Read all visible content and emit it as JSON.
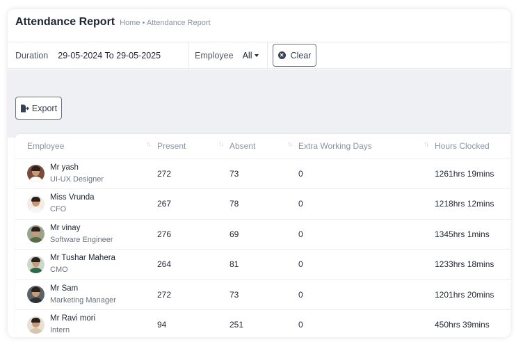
{
  "header": {
    "title": "Attendance Report",
    "breadcrumb": "Home • Attendance Report"
  },
  "filters": {
    "duration_label": "Duration",
    "duration_value": "29-05-2024 To 29-05-2025",
    "employee_label": "Employee",
    "employee_value": "All",
    "clear_label": "Clear"
  },
  "toolbar": {
    "export_label": "Export"
  },
  "table": {
    "columns": [
      "Employee",
      "Present",
      "Absent",
      "Extra Working Days",
      "Hours Clocked"
    ],
    "rows": [
      {
        "name": "Mr yash",
        "role": "UI-UX Designer",
        "present": "272",
        "absent": "73",
        "extra": "0",
        "hours": "1261hrs 19mins",
        "avatar_bg": "#7a4b3a",
        "shirt": "#ffffff"
      },
      {
        "name": "Miss Vrunda",
        "role": "CFO",
        "present": "267",
        "absent": "78",
        "extra": "0",
        "hours": "1218hrs 12mins",
        "avatar_bg": "#f1ece6",
        "shirt": "#f5f5f5"
      },
      {
        "name": "Mr vinay",
        "role": "Software Engineer",
        "present": "276",
        "absent": "69",
        "extra": "0",
        "hours": "1345hrs 1mins",
        "avatar_bg": "#9aa38c",
        "shirt": "#5a6b4a"
      },
      {
        "name": "Mr Tushar Mahera",
        "role": "CMO",
        "present": "264",
        "absent": "81",
        "extra": "0",
        "hours": "1233hrs 18mins",
        "avatar_bg": "#cfd8c8",
        "shirt": "#2f6b4a"
      },
      {
        "name": "Mr Sam",
        "role": "Marketing Manager",
        "present": "272",
        "absent": "73",
        "extra": "0",
        "hours": "1201hrs 20mins",
        "avatar_bg": "#5b6168",
        "shirt": "#2d3238"
      },
      {
        "name": "Mr Ravi mori",
        "role": "Intern",
        "present": "94",
        "absent": "251",
        "extra": "0",
        "hours": "450hrs 39mins",
        "avatar_bg": "#e7e0d6",
        "shirt": "#d8c4a8"
      }
    ]
  }
}
